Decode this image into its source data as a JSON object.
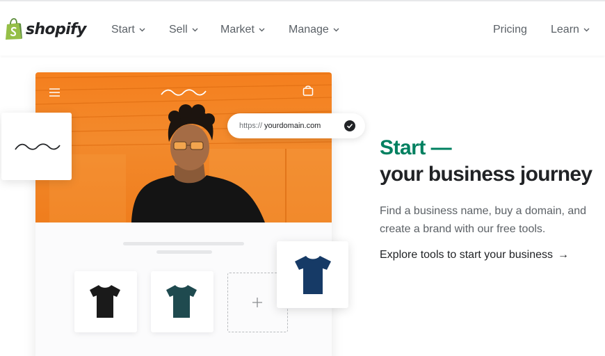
{
  "brand": {
    "name": "shopify",
    "logo_color": "#95bf47"
  },
  "nav": {
    "items": [
      {
        "label": "Start",
        "has_dropdown": true
      },
      {
        "label": "Sell",
        "has_dropdown": true
      },
      {
        "label": "Market",
        "has_dropdown": true
      },
      {
        "label": "Manage",
        "has_dropdown": true
      },
      {
        "label": "Pricing",
        "has_dropdown": false
      },
      {
        "label": "Learn",
        "has_dropdown": true
      }
    ]
  },
  "mockup": {
    "url_prefix": "https://",
    "url_domain": "yourdomain.com",
    "accent_orange": "#f47f1e",
    "products": [
      {
        "name": "black-tshirt",
        "color": "#1a1a1a"
      },
      {
        "name": "teal-tshirt",
        "color": "#1f4a4f"
      },
      {
        "name": "navy-tshirt",
        "color": "#163a66"
      }
    ]
  },
  "hero": {
    "headline_line1": "Start —",
    "headline_line2": "your business journey",
    "subtext": "Find a business name, buy a domain, and create a brand with our free tools.",
    "cta_label": "Explore tools to start your business",
    "cta_arrow": "→",
    "accent_color": "#008060"
  }
}
